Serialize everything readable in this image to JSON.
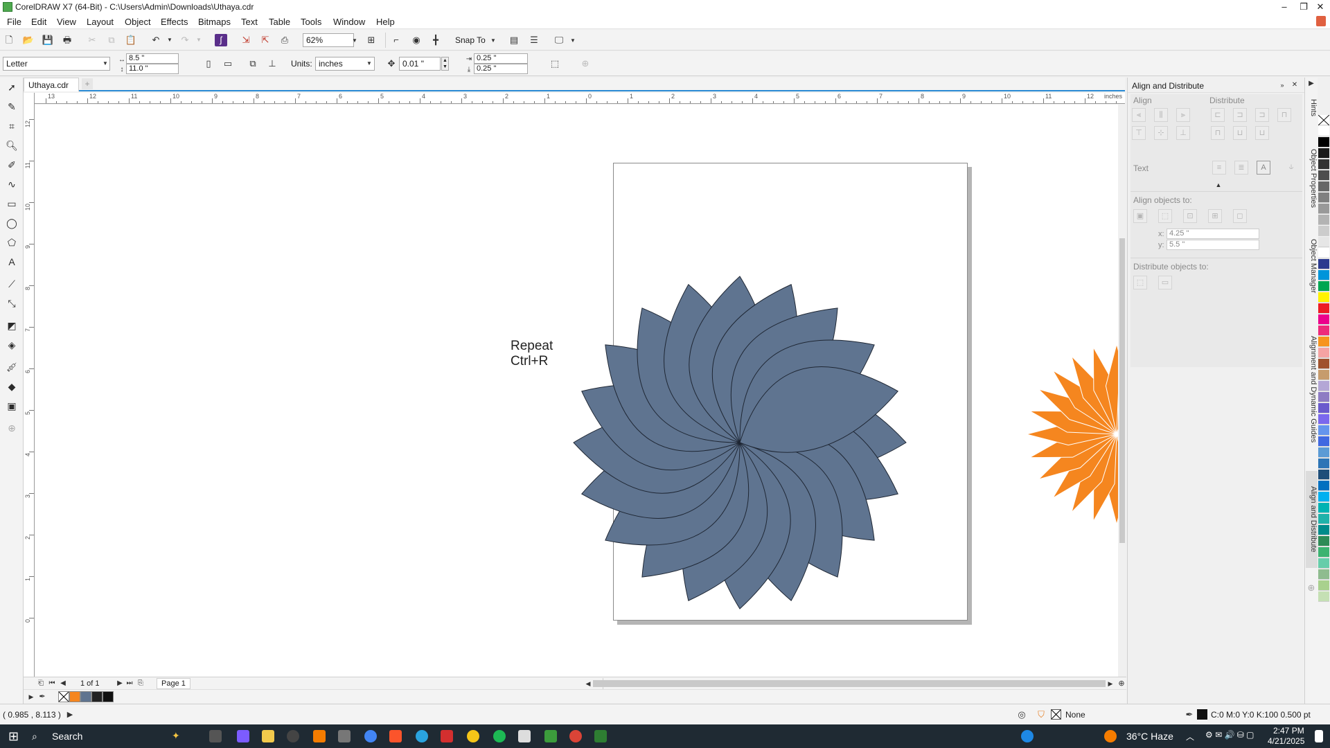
{
  "window": {
    "title": "CorelDRAW X7 (64-Bit) - C:\\Users\\Admin\\Downloads\\Uthaya.cdr",
    "minimize": "–",
    "maximize": "❐",
    "close": "✕"
  },
  "menu": [
    "File",
    "Edit",
    "View",
    "Layout",
    "Object",
    "Effects",
    "Bitmaps",
    "Text",
    "Table",
    "Tools",
    "Window",
    "Help"
  ],
  "toolbar": {
    "zoom": "62%",
    "snap_to": "Snap To"
  },
  "property_bar": {
    "paper_size": "Letter",
    "width": "8.5 \"",
    "height": "11.0 \"",
    "units_label": "Units:",
    "units": "inches",
    "nudge": "0.01 \"",
    "dup_x": "0.25 \"",
    "dup_y": "0.25 \""
  },
  "document_tab": {
    "name": "Uthaya.cdr",
    "add": "+"
  },
  "ruler": {
    "corner": "⊹",
    "unit": "inches",
    "h_labels": [
      "13",
      "12",
      "11",
      "10",
      "9",
      "8",
      "7",
      "6",
      "5",
      "4",
      "3",
      "2",
      "1",
      "0",
      "1",
      "2",
      "3",
      "4",
      "5",
      "6",
      "7",
      "8",
      "9",
      "10",
      "11",
      "12"
    ],
    "v_labels": [
      "12",
      "11",
      "10",
      "9",
      "8",
      "7",
      "6",
      "5",
      "4",
      "3",
      "2",
      "1",
      "0"
    ]
  },
  "canvas": {
    "text_line1": "Repeat",
    "text_line2": "Ctrl+R",
    "colors": {
      "flower": "#5f7490",
      "orange": "#f5861f",
      "page_shadow": "#b5b5b5"
    }
  },
  "page_nav": {
    "count": "1 of 1",
    "page_tab": "Page 1"
  },
  "document_palette": [
    "#ffffff",
    "#f5861f",
    "#5f7490",
    "#222222",
    "#111111"
  ],
  "status": {
    "coords": "( 0.985 , 8.113 )",
    "fill_label": "None",
    "outline": "C:0 M:0 Y:0 K:100  0.500 pt"
  },
  "docker": {
    "title": "Align and Distribute",
    "align": "Align",
    "distribute": "Distribute",
    "text": "Text",
    "align_objects_to": "Align objects to:",
    "x_label": "x:",
    "x_value": "4.25 \"",
    "y_label": "y:",
    "y_value": "5.5 \"",
    "distribute_objects_to": "Distribute objects to:"
  },
  "vertical_tabs": [
    "Hints",
    "Object Properties",
    "Object Manager",
    "Alignment and Dynamic Guides",
    "Align and Distribute"
  ],
  "color_palette": [
    "#ffffff",
    "#000000",
    "#1a1a1a",
    "#333333",
    "#4d4d4d",
    "#666666",
    "#808080",
    "#999999",
    "#b3b3b3",
    "#cccccc",
    "#e6e6e6",
    "#ffffff",
    "#2b3a8f",
    "#0095da",
    "#00a651",
    "#fff200",
    "#ed1c24",
    "#ec008c",
    "#ee2a7b",
    "#f7941d",
    "#f5a3a3",
    "#a0522d",
    "#c69c6d",
    "#b4a7d6",
    "#8e7cc3",
    "#6a5acd",
    "#7b68ee",
    "#6495ed",
    "#4169e1",
    "#5b9bd5",
    "#2e75b6",
    "#1f4e79",
    "#0070c0",
    "#00b0f0",
    "#00b3b3",
    "#20b2aa",
    "#008b8b",
    "#2e8b57",
    "#3cb371",
    "#66cdaa",
    "#8fbc8f",
    "#a9d18e",
    "#c5e0b4"
  ],
  "taskbar": {
    "search": "Search",
    "weather": "36°C  Haze",
    "time": "2:47 PM",
    "date": "4/21/2025"
  }
}
